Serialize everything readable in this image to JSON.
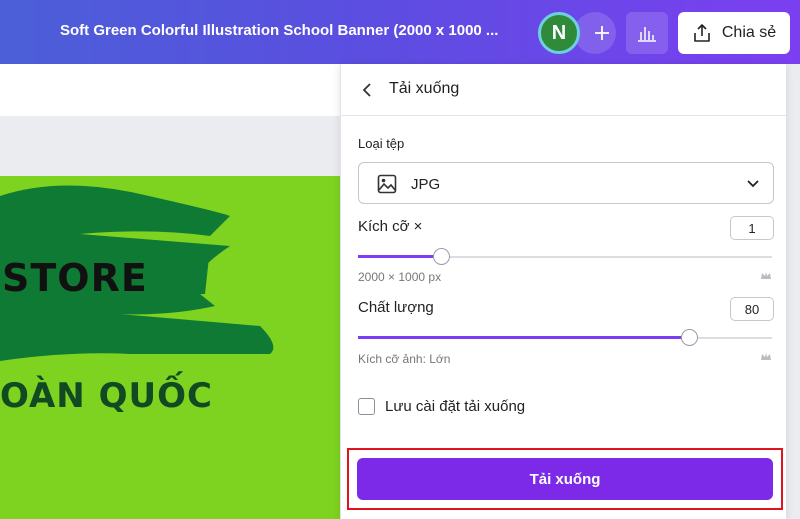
{
  "header": {
    "doc_title": "Soft Green Colorful Illustration School Banner (2000 x 1000 ...",
    "avatar_initial": "N",
    "share_label": "Chia sẻ"
  },
  "canvas": {
    "text_store": "STORE",
    "text_nation": "OÀN QUỐC"
  },
  "panel": {
    "title": "Tải xuống",
    "file_type_label": "Loại tệp",
    "file_type_value": "JPG",
    "size_label": "Kích cỡ ×",
    "size_value": "1",
    "size_hint": "2000 × 1000 px",
    "size_slider_fraction": 0.2,
    "quality_label": "Chất lượng",
    "quality_value": "80",
    "quality_hint": "Kích cỡ ảnh: Lớn",
    "quality_slider_fraction": 0.8,
    "save_settings_label": "Lưu cài đặt tải xuống",
    "save_settings_checked": false,
    "download_button": "Tải xuống"
  },
  "colors": {
    "accent": "#7d2ae8",
    "highlight_box": "#e0141e",
    "canvas_green": "#7ed321"
  }
}
